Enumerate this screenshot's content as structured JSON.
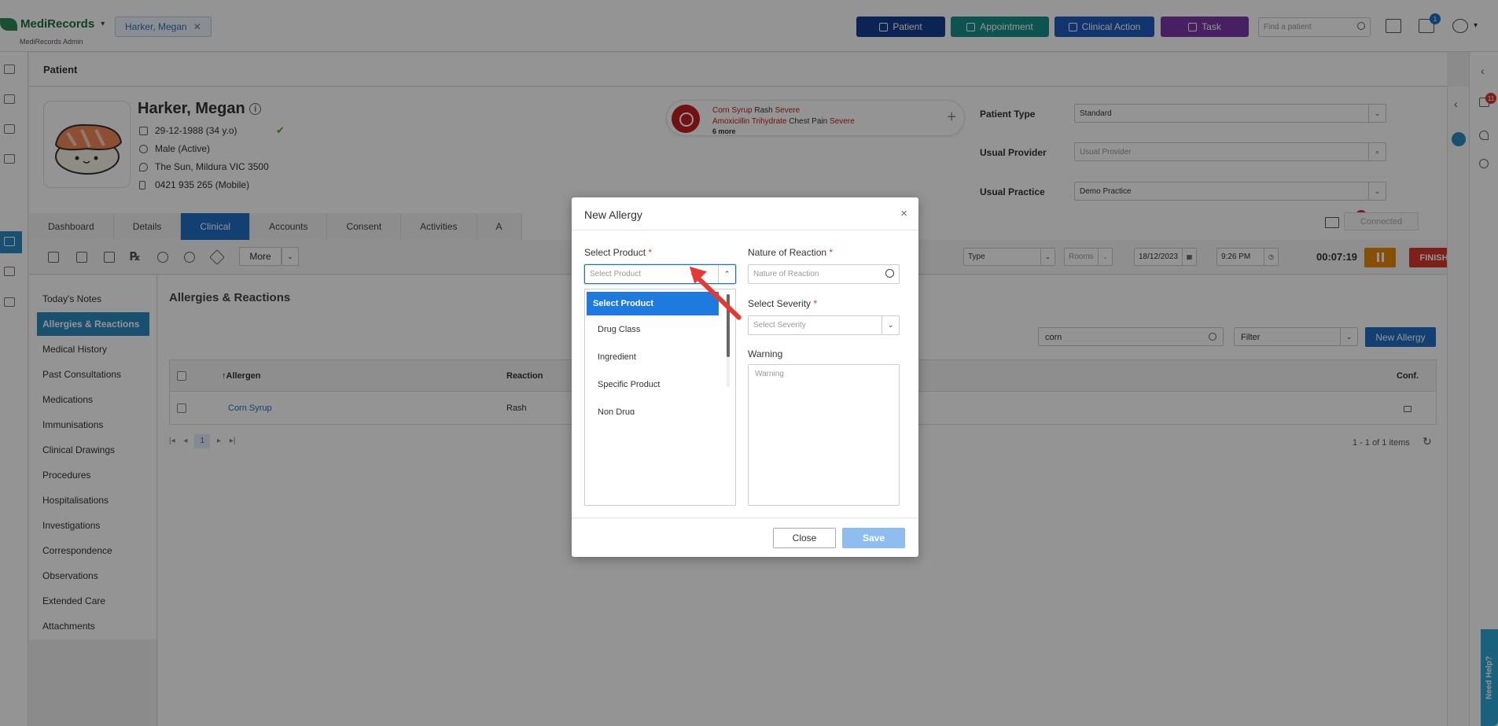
{
  "header": {
    "logo": "MediRecords",
    "logo_sub": "MediRecords Admin",
    "patient_tab": "Harker, Megan",
    "buttons": [
      {
        "label": "Patient",
        "color": "#153f8f"
      },
      {
        "label": "Appointment",
        "color": "#17928c"
      },
      {
        "label": "Clinical Action",
        "color": "#1f5bbf"
      },
      {
        "label": "Task",
        "color": "#7a38a8"
      }
    ],
    "find_placeholder": "Find a patient",
    "task_badge": "1"
  },
  "page_title": "Patient",
  "patient": {
    "name": "Harker, Megan",
    "dob": "29-12-1988 (34 y.o)",
    "gender": "Male (Active)",
    "address": "The Sun, Mildura VIC 3500",
    "phone": "0421 935 265 (Mobile)"
  },
  "allergy_summary": {
    "line1": {
      "allergen": "Corn Syrup",
      "reaction": "Rash",
      "severity": "Severe"
    },
    "line2": {
      "allergen": "Amoxicillin Trihydrate",
      "reaction": "Chest Pain",
      "severity": "Severe"
    },
    "more": "6 more"
  },
  "patient_fields": [
    {
      "label": "Patient Type",
      "value": "Standard",
      "placeholder": ""
    },
    {
      "label": "Usual Provider",
      "value": "",
      "placeholder": "Usual Provider"
    },
    {
      "label": "Usual Practice",
      "value": "Demo Practice",
      "placeholder": ""
    }
  ],
  "tabs": [
    "Dashboard",
    "Details",
    "Clinical",
    "Accounts",
    "Consent",
    "Activities",
    "A"
  ],
  "active_tab": "Clinical",
  "connected": "Connected",
  "mail_badge": "1",
  "right_badge": "11",
  "toolbar": {
    "more": "More",
    "type": "Type",
    "rooms": "Rooms",
    "date": "18/12/2023",
    "time": "9:26 PM",
    "timer": "00:07:19",
    "finish": "FINISH"
  },
  "clinical_menu": [
    "Today's Notes",
    "Allergies & Reactions",
    "Medical History",
    "Past Consultations",
    "Medications",
    "Immunisations",
    "Clinical Drawings",
    "Procedures",
    "Hospitalisations",
    "Investigations",
    "Correspondence",
    "Observations",
    "Extended Care",
    "Attachments"
  ],
  "active_menu": "Allergies & Reactions",
  "content": {
    "title": "Allergies & Reactions",
    "search_value": "corn",
    "filter": "Filter",
    "new_allergy": "New Allergy",
    "columns": [
      "↑Allergen",
      "Reaction",
      "Conf."
    ],
    "rows": [
      {
        "allergen": "Corn Syrup",
        "reaction": "Rash"
      }
    ],
    "page": "1",
    "items_text": "1 - 1 of 1 items"
  },
  "modal": {
    "title": "New Allergy",
    "select_product_label": "Select Product",
    "select_product_placeholder": "Select Product",
    "nature_label": "Nature of Reaction",
    "nature_placeholder": "Nature of Reaction",
    "severity_label": "Select Severity",
    "severity_placeholder": "Select Severity",
    "warning_label": "Warning",
    "warning_placeholder": "Warning",
    "options": [
      "Select Product",
      "Drug Class",
      "Ingredient",
      "Specific Product",
      "Non Drug"
    ],
    "close": "Close",
    "save": "Save",
    "close_x": "×"
  },
  "need_help": "Need Help?"
}
